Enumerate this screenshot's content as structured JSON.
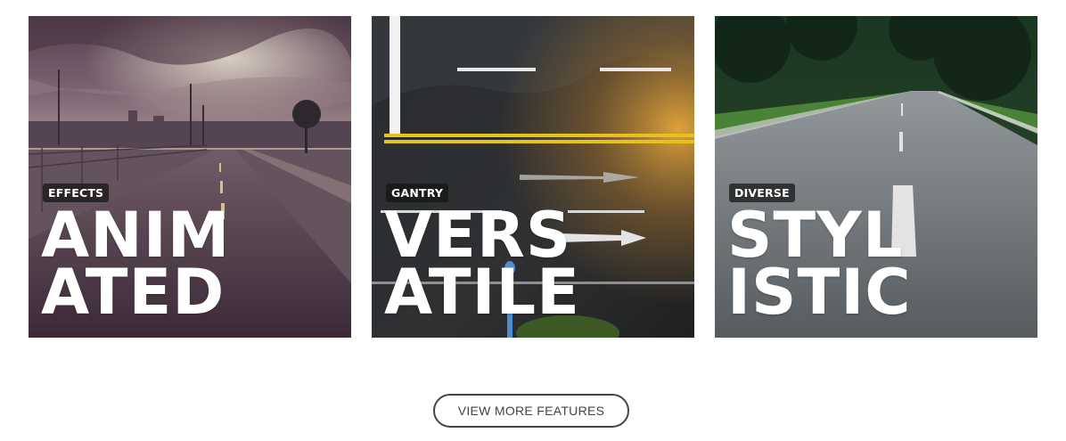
{
  "cards": [
    {
      "tag": "EFFECTS",
      "line1": "ANIM",
      "line2": "ATED",
      "scene": "sunset-road"
    },
    {
      "tag": "GANTRY",
      "line1": "VERS",
      "line2": "ATILE",
      "scene": "asphalt-markings"
    },
    {
      "tag": "DIVERSE",
      "line1": "STYL",
      "line2": "ISTIC",
      "scene": "forest-road"
    }
  ],
  "cta": {
    "label": "VIEW MORE FEATURES"
  },
  "colors": {
    "tag_bg": "#1e1e1e",
    "heading": "#ffffff",
    "button_border": "#444444"
  }
}
